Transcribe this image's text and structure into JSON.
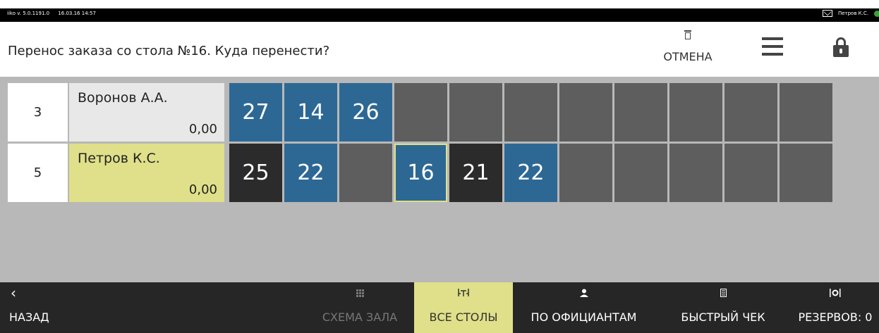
{
  "statusbar": {
    "version": "iiko v. 5.0.1191.0",
    "datetime": "16.03.16  14:57",
    "user": "Петров К.С."
  },
  "header": {
    "title": "Перенос заказа со стола №16. Куда перенести?",
    "cancel_label": "ОТМЕНА"
  },
  "waiters": [
    {
      "number": "3",
      "name": "Воронов А.А.",
      "sum": "0,00",
      "tables": [
        {
          "label": "27",
          "state": "blue"
        },
        {
          "label": "14",
          "state": "blue"
        },
        {
          "label": "26",
          "state": "blue"
        },
        {
          "label": "",
          "state": "empty"
        },
        {
          "label": "",
          "state": "empty"
        },
        {
          "label": "",
          "state": "empty"
        },
        {
          "label": "",
          "state": "empty"
        },
        {
          "label": "",
          "state": "empty"
        },
        {
          "label": "",
          "state": "empty"
        },
        {
          "label": "",
          "state": "empty"
        },
        {
          "label": "",
          "state": "empty"
        }
      ]
    },
    {
      "number": "5",
      "name": "Петров К.С.",
      "sum": "0,00",
      "tables": [
        {
          "label": "25",
          "state": "dark"
        },
        {
          "label": "22",
          "state": "blue"
        },
        {
          "label": "",
          "state": "empty"
        },
        {
          "label": "16",
          "state": "sel"
        },
        {
          "label": "21",
          "state": "dark"
        },
        {
          "label": "22",
          "state": "blue"
        },
        {
          "label": "",
          "state": "empty"
        },
        {
          "label": "",
          "state": "empty"
        },
        {
          "label": "",
          "state": "empty"
        },
        {
          "label": "",
          "state": "empty"
        },
        {
          "label": "",
          "state": "empty"
        }
      ]
    }
  ],
  "bottom_nav": {
    "back_label": "НАЗАД",
    "hall_label": "СХЕМА ЗАЛА",
    "all_tables_label": "ВСЕ СТОЛЫ",
    "by_waiters_label": "ПО ОФИЦИАНТАМ",
    "quick_check_label": "БЫСТРЫЙ ЧЕК",
    "reserves_label": "РЕЗЕРВОВ: 0"
  },
  "colors": {
    "table_blue": "#2d6894",
    "table_dark": "#2b2b2b",
    "table_empty": "#5e5e5e",
    "accent_yellow": "#dfe089"
  },
  "icons": [
    "trash-icon",
    "menu-icon",
    "lock-icon",
    "mail-icon",
    "grid-icon",
    "tables-icon",
    "waiter-icon",
    "receipt-icon",
    "reserve-icon"
  ]
}
